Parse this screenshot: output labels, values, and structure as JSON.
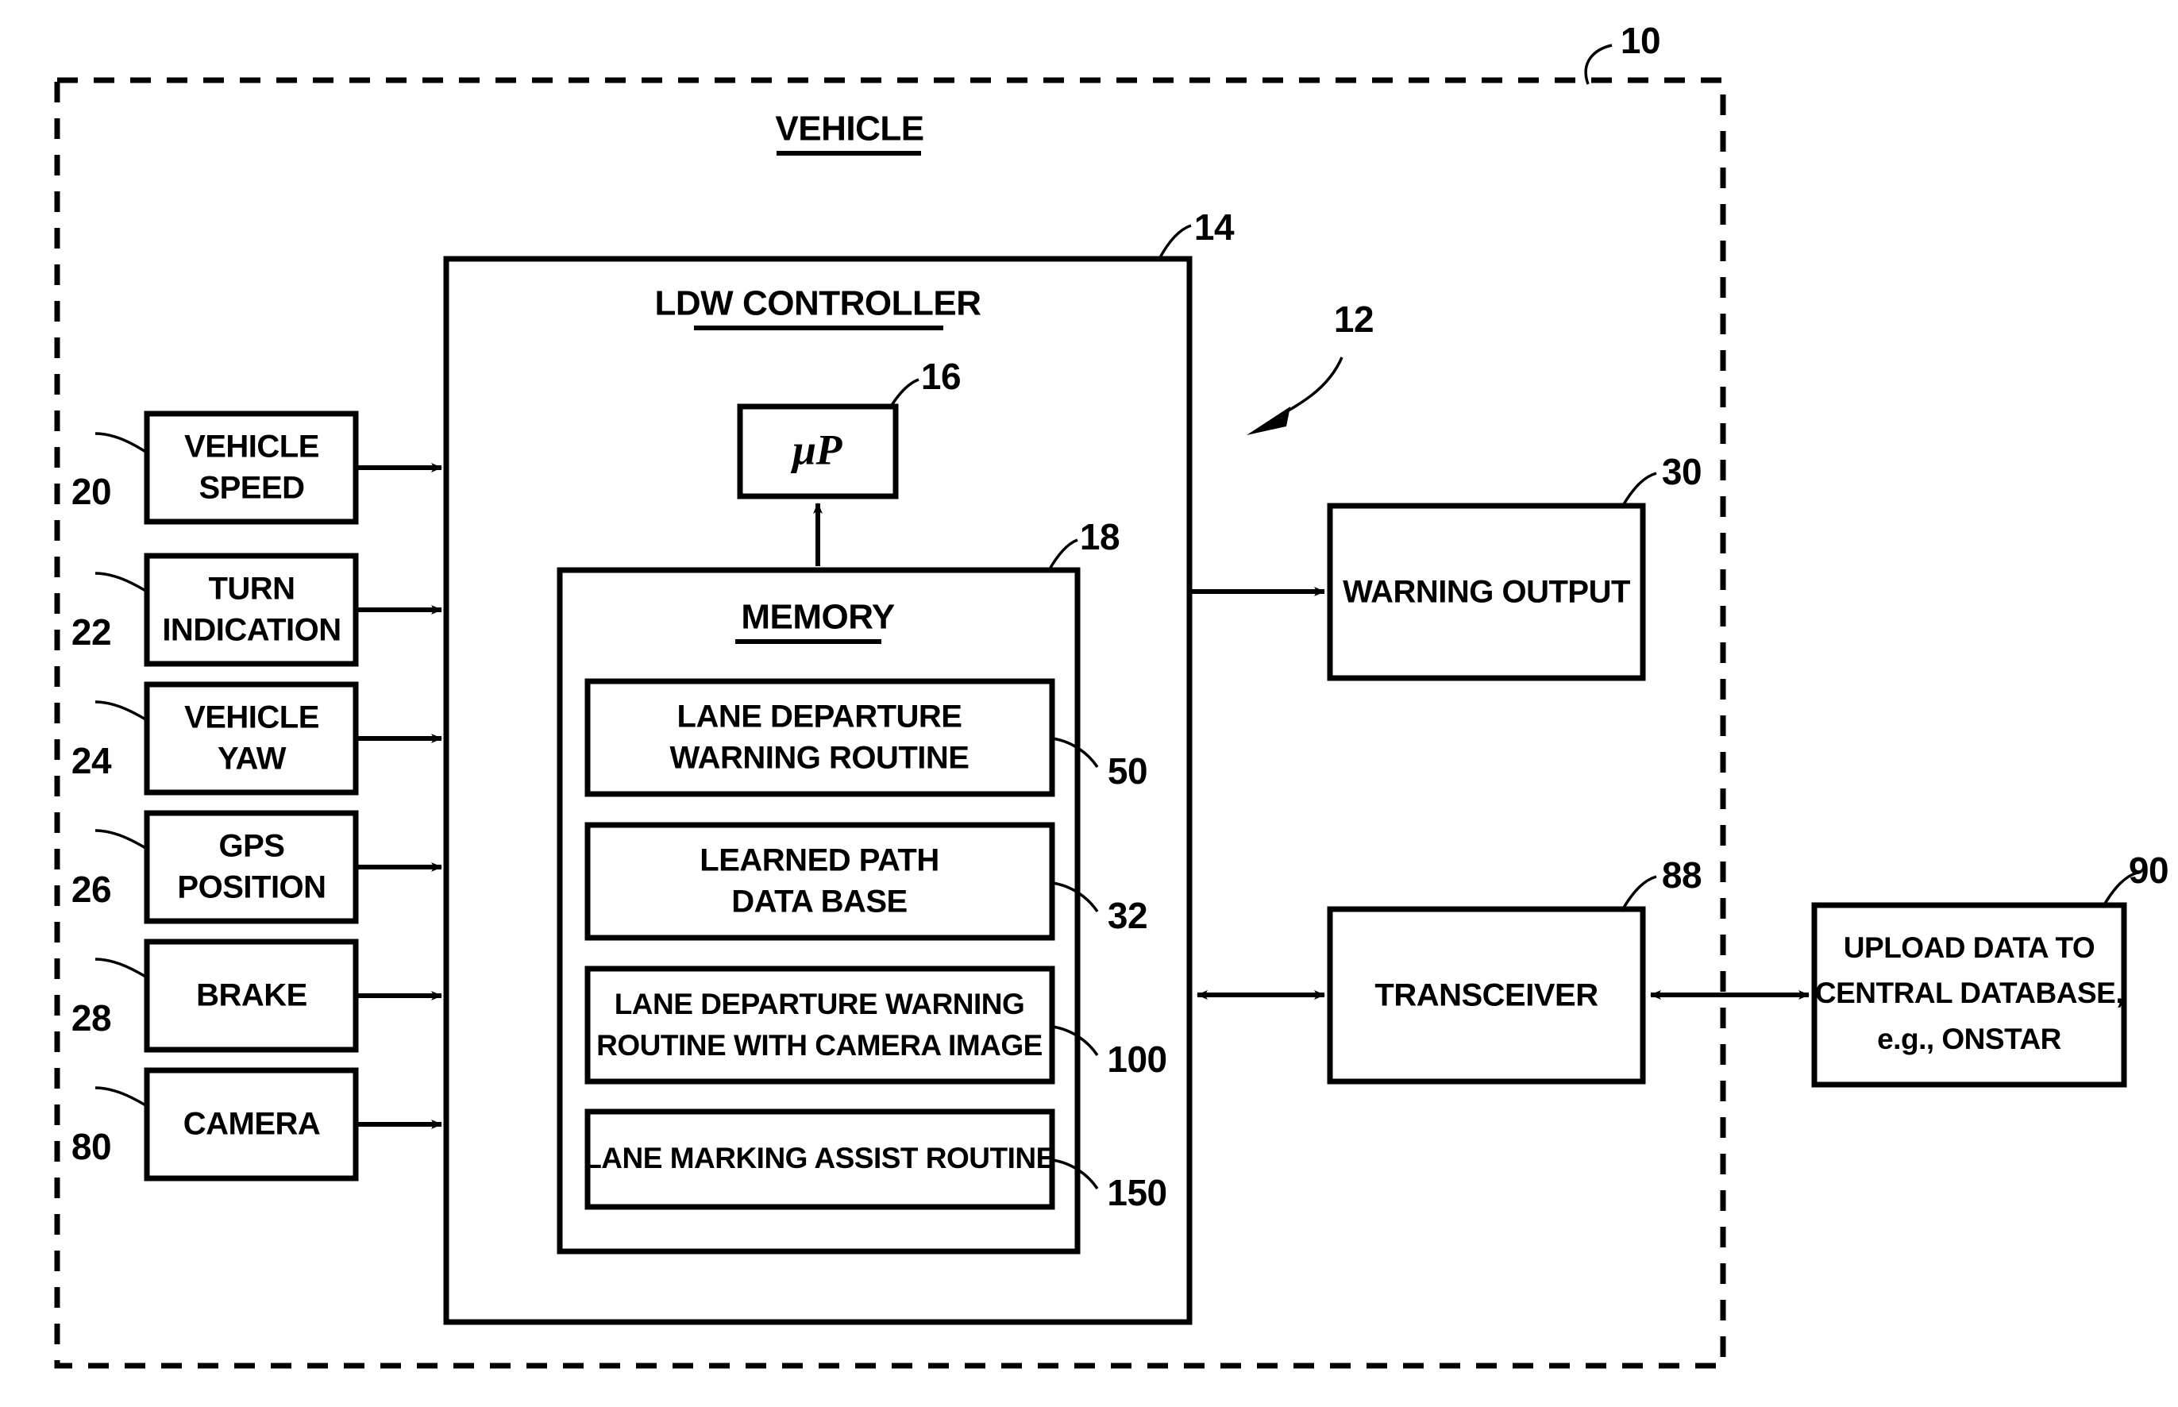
{
  "figure": {
    "system_ref": "10",
    "system_arrow_ref": "12",
    "boundary_label": "VEHICLE"
  },
  "controller": {
    "title": "LDW CONTROLLER",
    "ref": "14",
    "processor": {
      "label": "μP",
      "ref": "16"
    },
    "memory": {
      "title": "MEMORY",
      "ref": "18",
      "items": [
        {
          "line1": "LANE DEPARTURE",
          "line2": "WARNING ROUTINE",
          "ref": "50"
        },
        {
          "line1": "LEARNED PATH",
          "line2": "DATA BASE",
          "ref": "32"
        },
        {
          "line1": "LANE DEPARTURE WARNING",
          "line2": "ROUTINE WITH CAMERA IMAGE",
          "ref": "100"
        },
        {
          "line1": "LANE MARKING ASSIST ROUTINE",
          "line2": "",
          "ref": "150"
        }
      ]
    }
  },
  "inputs": [
    {
      "line1": "VEHICLE",
      "line2": "SPEED",
      "ref": "20"
    },
    {
      "line1": "TURN",
      "line2": "INDICATION",
      "ref": "22"
    },
    {
      "line1": "VEHICLE",
      "line2": "YAW",
      "ref": "24"
    },
    {
      "line1": "GPS",
      "line2": "POSITION",
      "ref": "26"
    },
    {
      "line1": "BRAKE",
      "line2": "",
      "ref": "28"
    },
    {
      "line1": "CAMERA",
      "line2": "",
      "ref": "80"
    }
  ],
  "outputs": {
    "warning": {
      "label": "WARNING OUTPUT",
      "ref": "30"
    },
    "transceiver": {
      "label": "TRANSCEIVER",
      "ref": "88"
    },
    "upload": {
      "line1": "UPLOAD DATA TO",
      "line2": "CENTRAL DATABASE,",
      "line3": "e.g., ONSTAR",
      "ref": "90"
    }
  },
  "colors": {
    "ink": "#000000",
    "paper": "#ffffff"
  }
}
